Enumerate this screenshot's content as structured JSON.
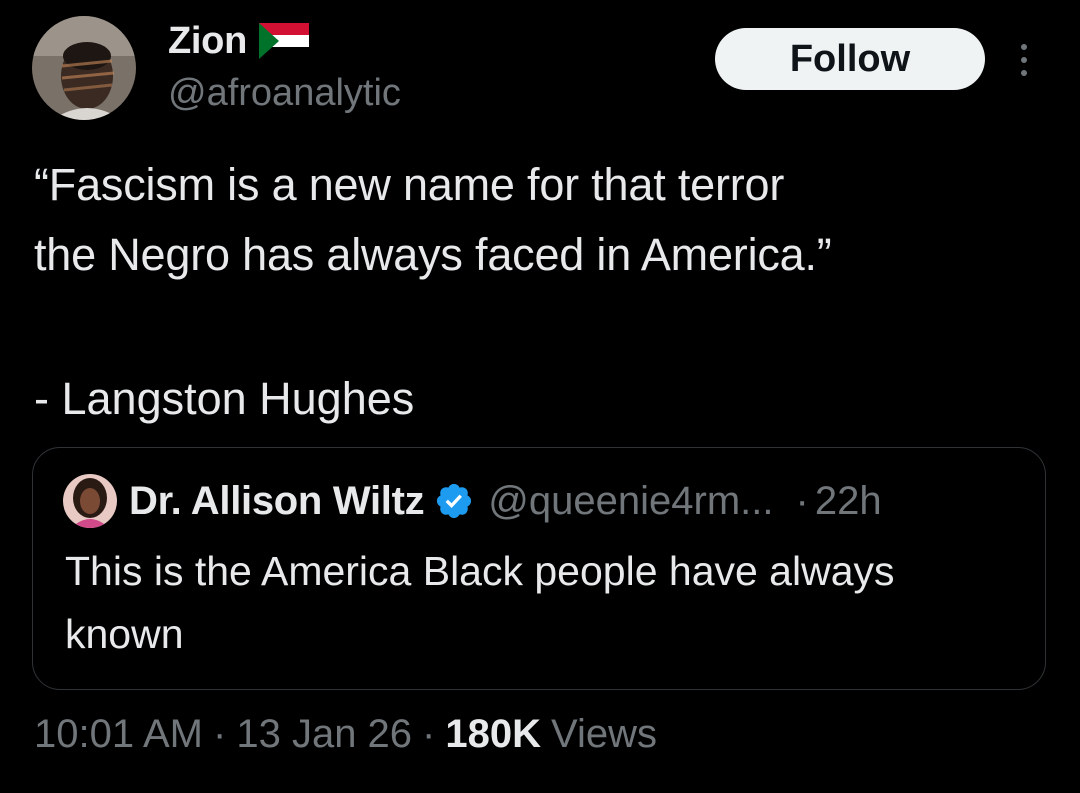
{
  "author": {
    "display_name": "Zion",
    "flag_icon": "sudan-flag-icon",
    "handle": "@afroanalytic",
    "avatar_icon": "profile-photo"
  },
  "actions": {
    "follow_label": "Follow",
    "more_icon": "more-vertical-icon"
  },
  "tweet": {
    "text": "“Fascism is a new name for that terror\nthe Negro has always faced in America.”",
    "attribution": "- Langston Hughes"
  },
  "quoted_tweet": {
    "display_name": "Dr. Allison Wiltz",
    "verified_icon": "verified-badge-icon",
    "handle": "@queenie4rm...",
    "separator": "·",
    "time": "22h",
    "text": "This is the America Black people have always known"
  },
  "meta": {
    "time": "10:01 AM",
    "separator": "·",
    "date": "13 Jan 26",
    "views_count": "180K",
    "views_label": "Views"
  },
  "colors": {
    "background": "#000000",
    "primary_text": "#e7e9ea",
    "secondary_text": "#71767b",
    "border": "#2f3336",
    "verified_blue": "#1d9bf0",
    "follow_button_bg": "#eff3f4"
  }
}
